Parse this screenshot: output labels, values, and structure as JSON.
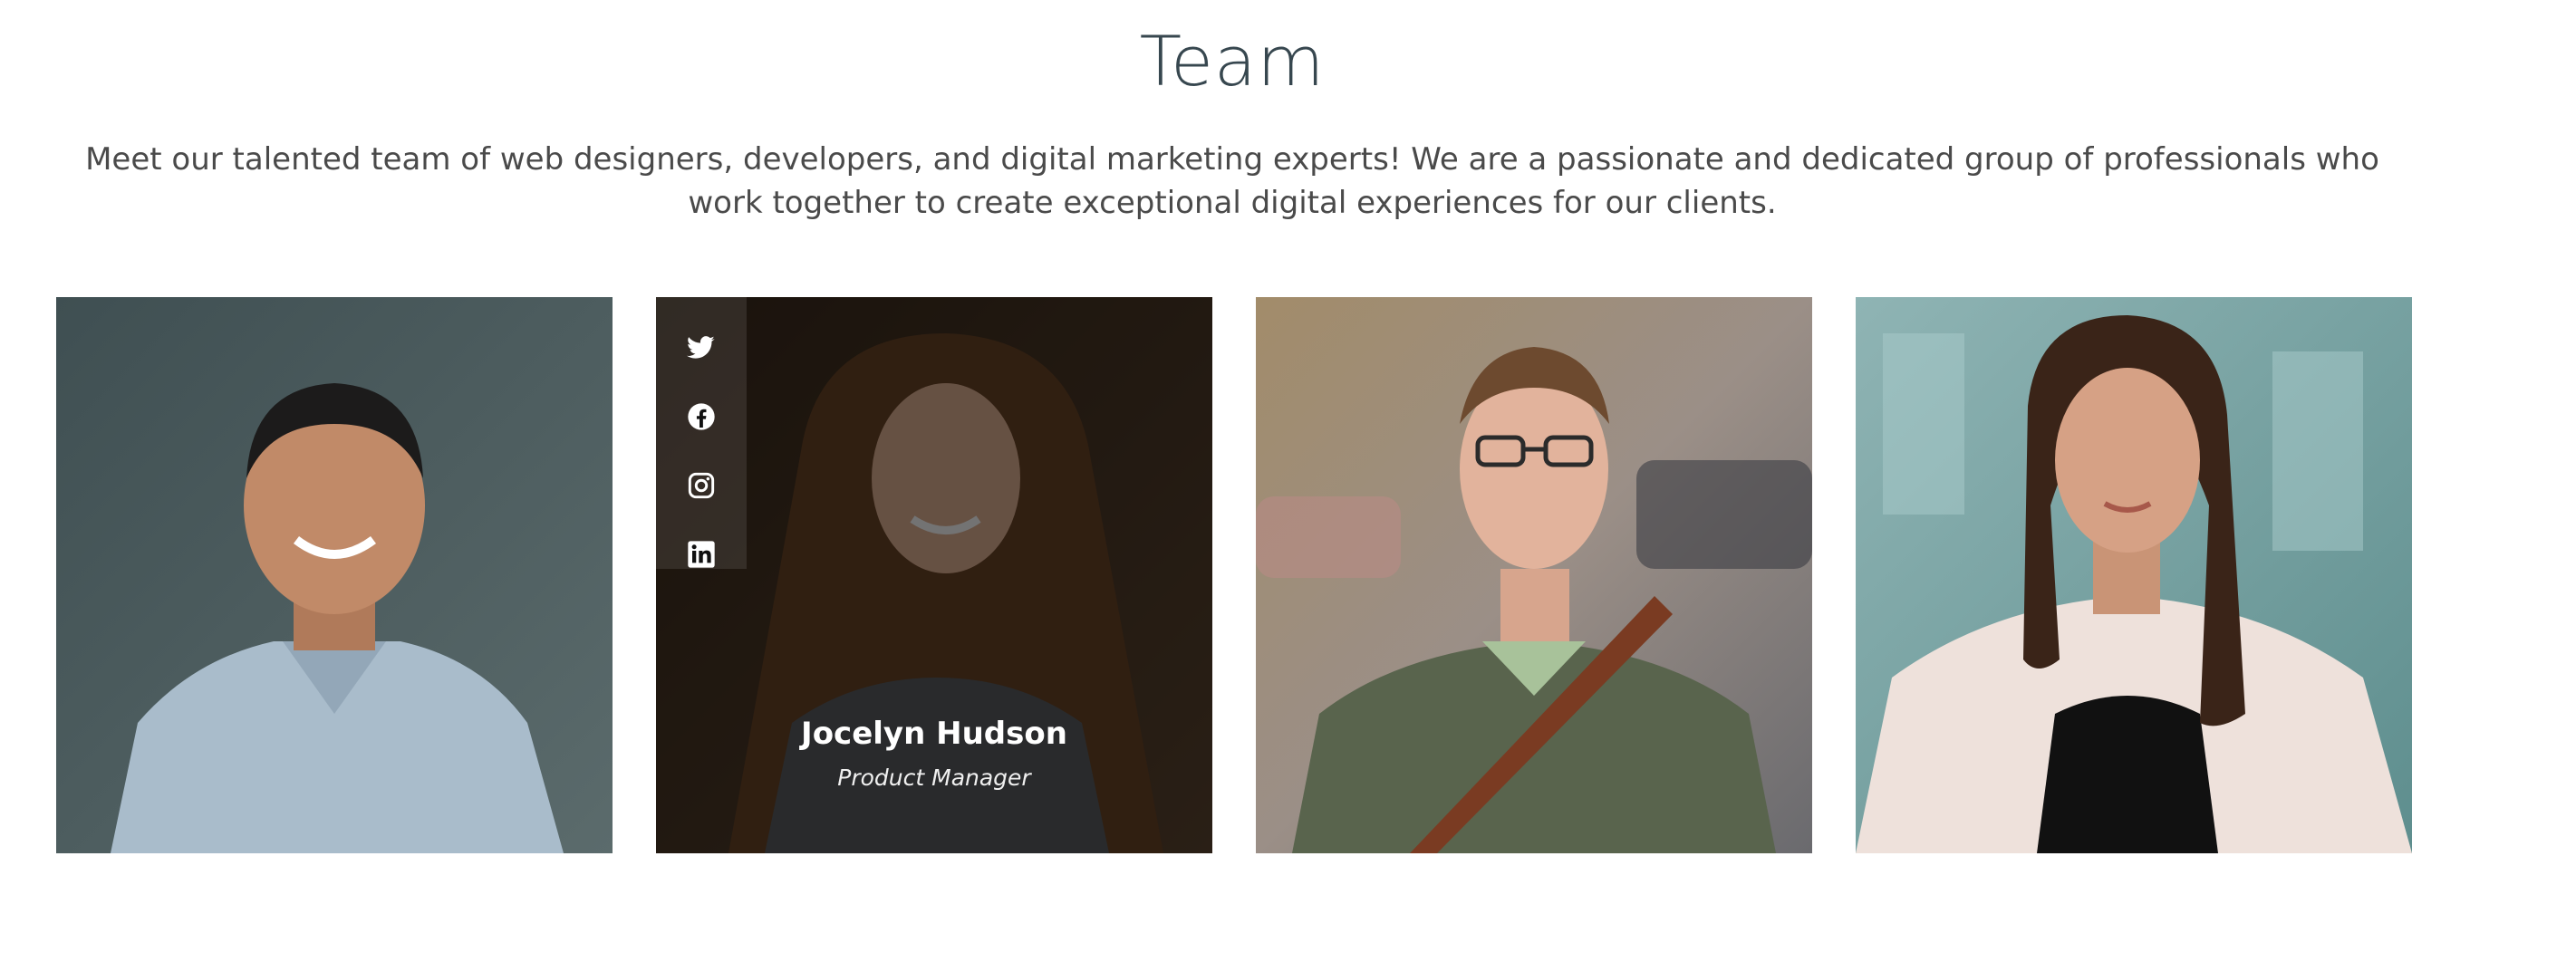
{
  "section": {
    "title": "Team",
    "intro": "Meet our talented team of web designers, developers, and digital marketing experts! We are a passionate and dedicated group of professionals who work together to create exceptional digital experiences for our clients."
  },
  "members": [
    {
      "photo_icon": "portrait-man-blue-shirt"
    },
    {
      "name": "Jocelyn Hudson",
      "role": "Product Manager",
      "photo_icon": "portrait-woman-long-hair",
      "social": [
        "twitter-icon",
        "facebook-icon",
        "instagram-icon",
        "linkedin-icon"
      ]
    },
    {
      "photo_icon": "portrait-man-glasses"
    },
    {
      "photo_icon": "portrait-woman-cardigan"
    }
  ],
  "colors": {
    "title": "#37474f",
    "text": "#4a4a4a",
    "overlay": "#000000"
  }
}
